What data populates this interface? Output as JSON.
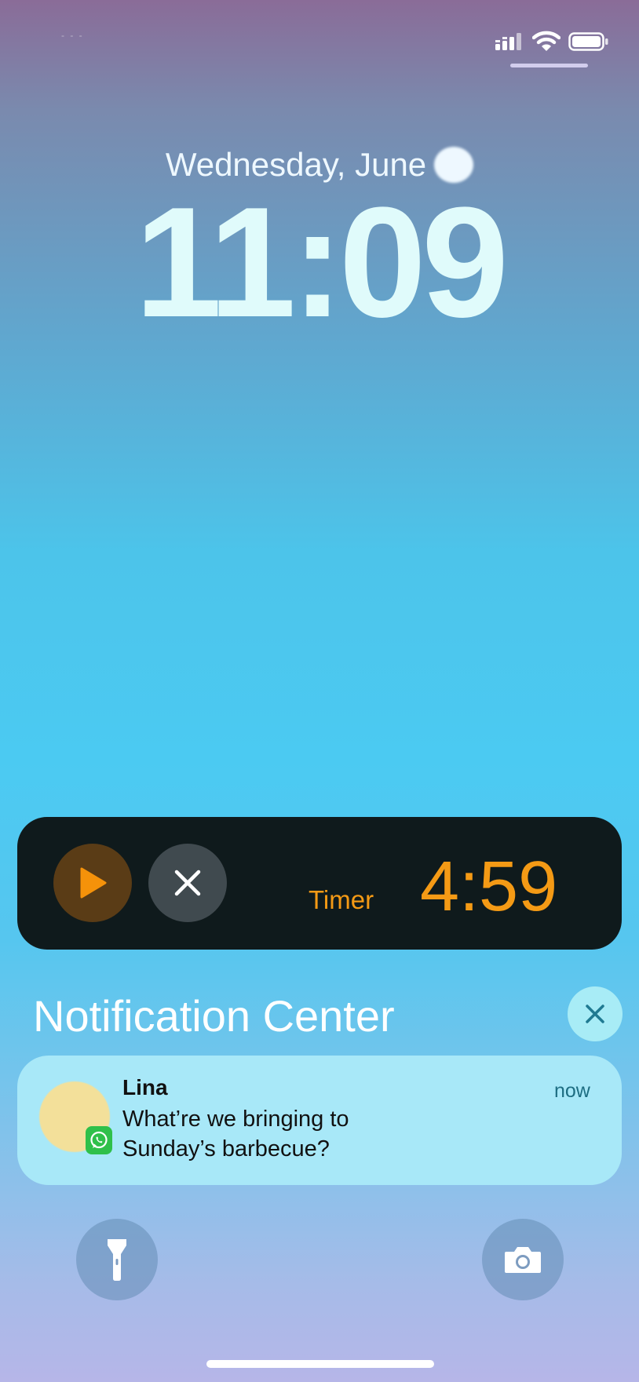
{
  "status_bar": {
    "carrier": "- - -",
    "icons": [
      "cellular-signal-icon",
      "wifi-icon",
      "battery-icon"
    ]
  },
  "lock_screen": {
    "date": "Wednesday, June",
    "time": "11:09"
  },
  "live_activity": {
    "label": "Timer",
    "remaining": "4:59",
    "accent_color": "#f49a15",
    "controls": [
      "play-icon",
      "close-icon"
    ]
  },
  "notification_center": {
    "title": "Notification Center",
    "notifications": [
      {
        "sender": "Lina",
        "time": "now",
        "app_icon": "whatsapp-icon",
        "line1": "What’re we bringing to",
        "line2": "Sunday’s barbecue?"
      }
    ]
  },
  "quick_actions": {
    "left": "flashlight-icon",
    "right": "camera-icon"
  }
}
